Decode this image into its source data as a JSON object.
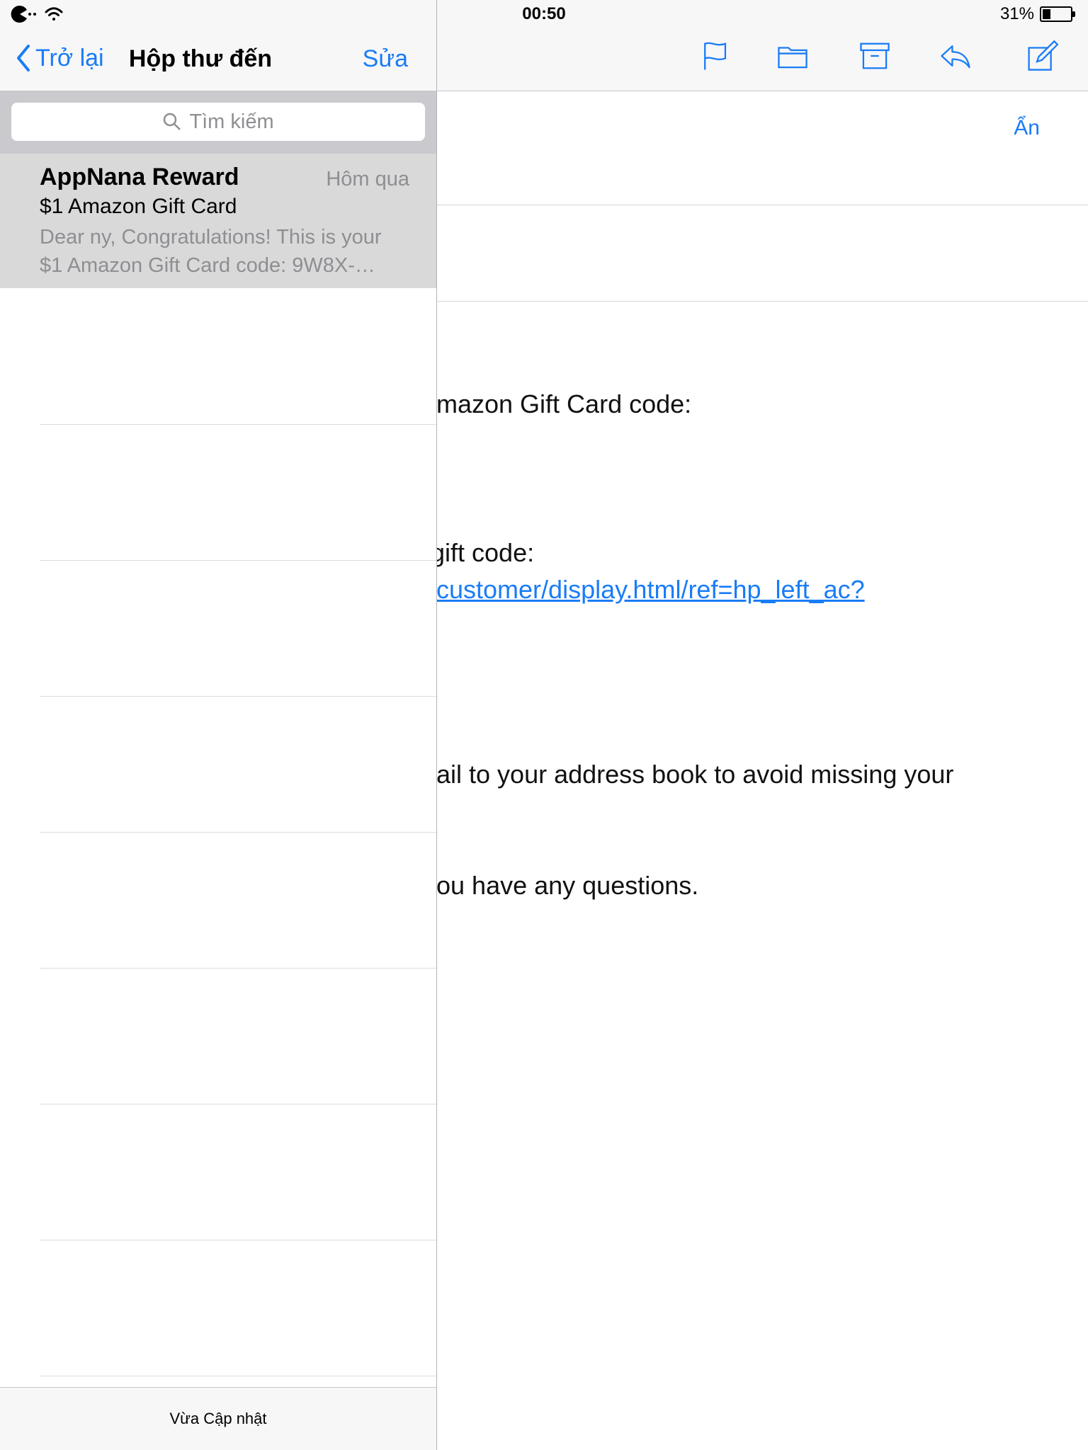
{
  "status_bar": {
    "time": "00:50",
    "battery_percent": "31%",
    "battery_level": 0.31
  },
  "sidebar": {
    "back_label": "Trở lại",
    "title": "Hộp thư đến",
    "edit_label": "Sửa",
    "search_placeholder": "Tìm kiếm",
    "messages": [
      {
        "sender": "AppNana Reward",
        "date": "Hôm qua",
        "subject": "$1 Amazon Gift Card",
        "preview_line1": "Dear ny, Congratulations! This is your",
        "preview_line2": "$1 Amazon Gift Card code: 9W8X-…"
      }
    ],
    "footer_status": "Vừa Cập nhật"
  },
  "toolbar": {
    "icons": [
      "flag-icon",
      "folder-icon",
      "archive-icon",
      "reply-icon",
      "compose-icon"
    ]
  },
  "reader": {
    "hide_label": "Ẩn",
    "body_lines": [
      "mazon Gift Card code:",
      "gift code:",
      "ail to your address book to avoid missing your",
      "ou have any questions."
    ],
    "link_text": "customer/display.html/ref=hp_left_ac?"
  },
  "colors": {
    "accent": "#1a7cf6",
    "selected_row": "#d9d9d9",
    "bar_bg": "#f7f7f8"
  }
}
